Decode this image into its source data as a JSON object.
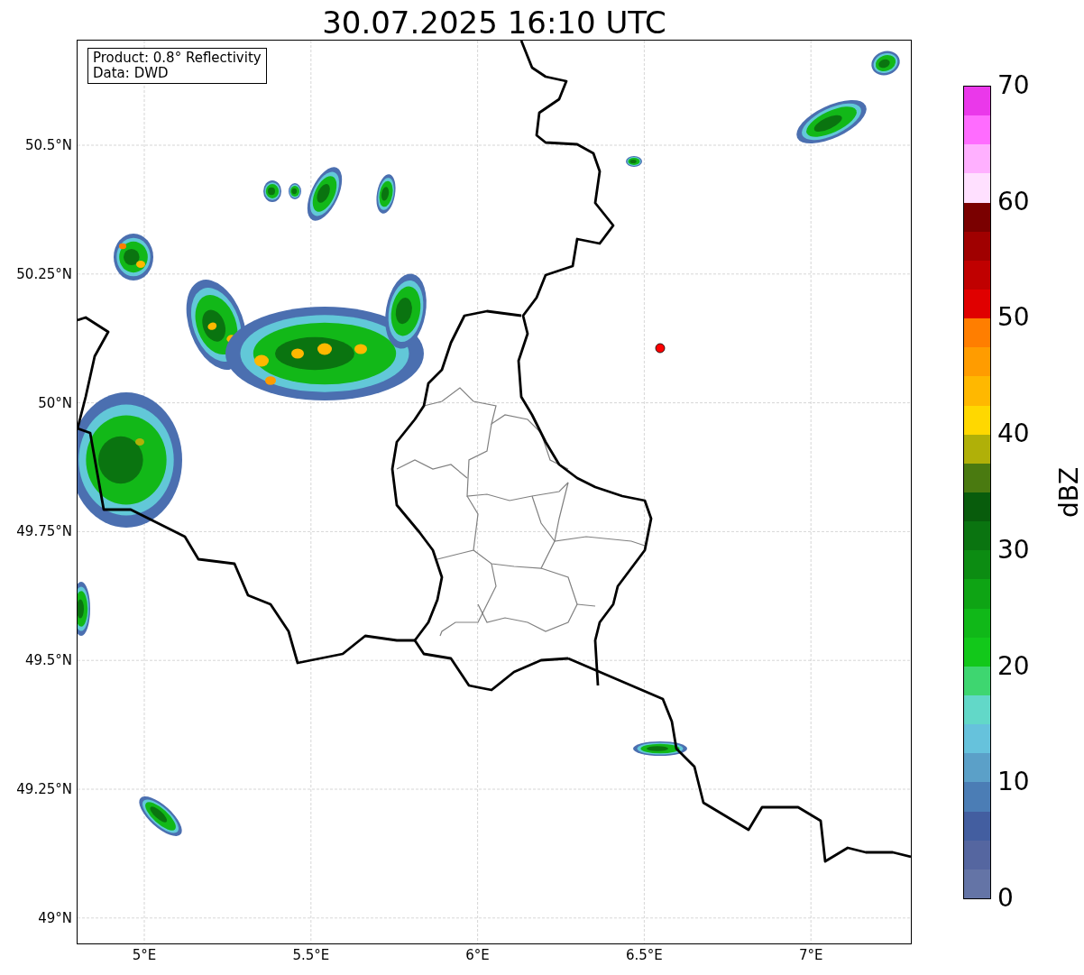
{
  "title": "30.07.2025 16:10 UTC",
  "legend": [
    "Product: 0.8° Reflectivity",
    "Data: DWD"
  ],
  "map": {
    "lat_ticks": [
      "50.5°N",
      "50.25°N",
      "50°N",
      "49.75°N",
      "49.5°N",
      "49.25°N",
      "49°N"
    ],
    "lon_ticks": [
      "5°E",
      "5.5°E",
      "6°E",
      "6.5°E",
      "7°E"
    ]
  },
  "colorbar": {
    "label": "dBZ",
    "ticks": [
      "70",
      "60",
      "50",
      "40",
      "30",
      "20",
      "10",
      "0"
    ],
    "segments": [
      {
        "color": "#6474a6"
      },
      {
        "color": "#5566a0"
      },
      {
        "color": "#435ea0"
      },
      {
        "color": "#4b7db5"
      },
      {
        "color": "#5ba0c8"
      },
      {
        "color": "#66c2dc"
      },
      {
        "color": "#62d8c8"
      },
      {
        "color": "#3ed670"
      },
      {
        "color": "#12c81a"
      },
      {
        "color": "#10b818"
      },
      {
        "color": "#0ea414"
      },
      {
        "color": "#0c8c12"
      },
      {
        "color": "#0a7410"
      },
      {
        "color": "#085c0c"
      },
      {
        "color": "#4a7a10"
      },
      {
        "color": "#b0b008"
      },
      {
        "color": "#ffd800"
      },
      {
        "color": "#ffb800"
      },
      {
        "color": "#ff9c00"
      },
      {
        "color": "#ff7e00"
      },
      {
        "color": "#e00000"
      },
      {
        "color": "#c00000"
      },
      {
        "color": "#a00000"
      },
      {
        "color": "#7a0000"
      },
      {
        "color": "#ffe0ff"
      },
      {
        "color": "#ffb0ff"
      },
      {
        "color": "#ff6cff"
      },
      {
        "color": "#ea38ea"
      }
    ]
  }
}
